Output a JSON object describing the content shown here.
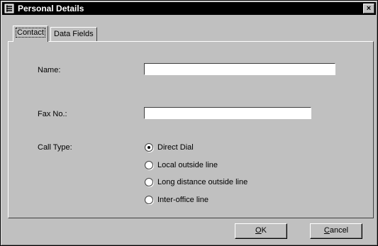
{
  "window": {
    "title": "Personal Details",
    "close_glyph": "×"
  },
  "tabs": [
    {
      "label": "Contact",
      "active": true
    },
    {
      "label": "Data Fields",
      "active": false
    }
  ],
  "fields": {
    "name": {
      "label": "Name:",
      "value": ""
    },
    "fax": {
      "label": "Fax No.:",
      "value": ""
    }
  },
  "call_type": {
    "label": "Call Type:",
    "options": [
      {
        "label": "Direct Dial",
        "checked": true
      },
      {
        "label": "Local outside line",
        "checked": false
      },
      {
        "label": "Long distance outside line",
        "checked": false
      },
      {
        "label": "Inter-office line",
        "checked": false
      }
    ]
  },
  "buttons": {
    "ok_mnemonic": "O",
    "ok_rest": "K",
    "cancel_mnemonic": "C",
    "cancel_rest": "ancel"
  }
}
